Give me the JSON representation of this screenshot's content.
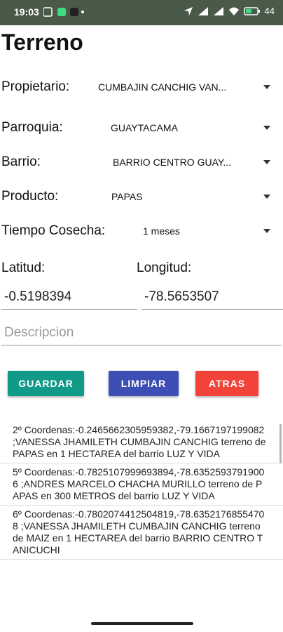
{
  "status": {
    "time": "19:03",
    "battery": "44"
  },
  "title": "Terreno",
  "fields": {
    "propietario": {
      "label": "Propietario:",
      "value": "CUMBAJIN CANCHIG VAN..."
    },
    "parroquia": {
      "label": "Parroquia:",
      "value": "GUAYTACAMA"
    },
    "barrio": {
      "label": "Barrio:",
      "value": "BARRIO CENTRO GUAY..."
    },
    "producto": {
      "label": "Producto:",
      "value": "PAPAS"
    },
    "tiempo": {
      "label": "Tiempo Cosecha:",
      "value": "1 meses"
    }
  },
  "coords": {
    "lat_label": "Latitud:",
    "lat_value": "-0.5198394",
    "lon_label": "Longitud:",
    "lon_value": "-78.5653507"
  },
  "descripcion": {
    "placeholder": "Descripcion"
  },
  "buttons": {
    "guardar": {
      "label": "GUARDAR",
      "color": "#119a88"
    },
    "limpiar": {
      "label": "LIMPIAR",
      "color": "#3d4eb4"
    },
    "atras": {
      "label": "ATRAS",
      "color": "#f2433a"
    }
  },
  "records": [
    "2º Coordenas:-0.2465662305959382,-79.1667197199082 ;VANESSA JHAMILETH CUMBAJIN CANCHIG terreno de  PAPAS en 1 HECTAREA del barrio LUZ Y VIDA",
    "5º Coordenas:-0.7825107999693894,-78.63525937919006 ;ANDRES MARCELO CHACHA MURILLO terreno de  PAPAS en 300 METROS del barrio LUZ Y VIDA",
    "6º Coordenas:-0.7802074412504819,-78.63521768554708 ;VANESSA JHAMILETH CUMBAJIN CANCHIG terreno de  MAIZ en 1 HECTAREA del barrio BARRIO CENTRO TANICUCHI"
  ]
}
